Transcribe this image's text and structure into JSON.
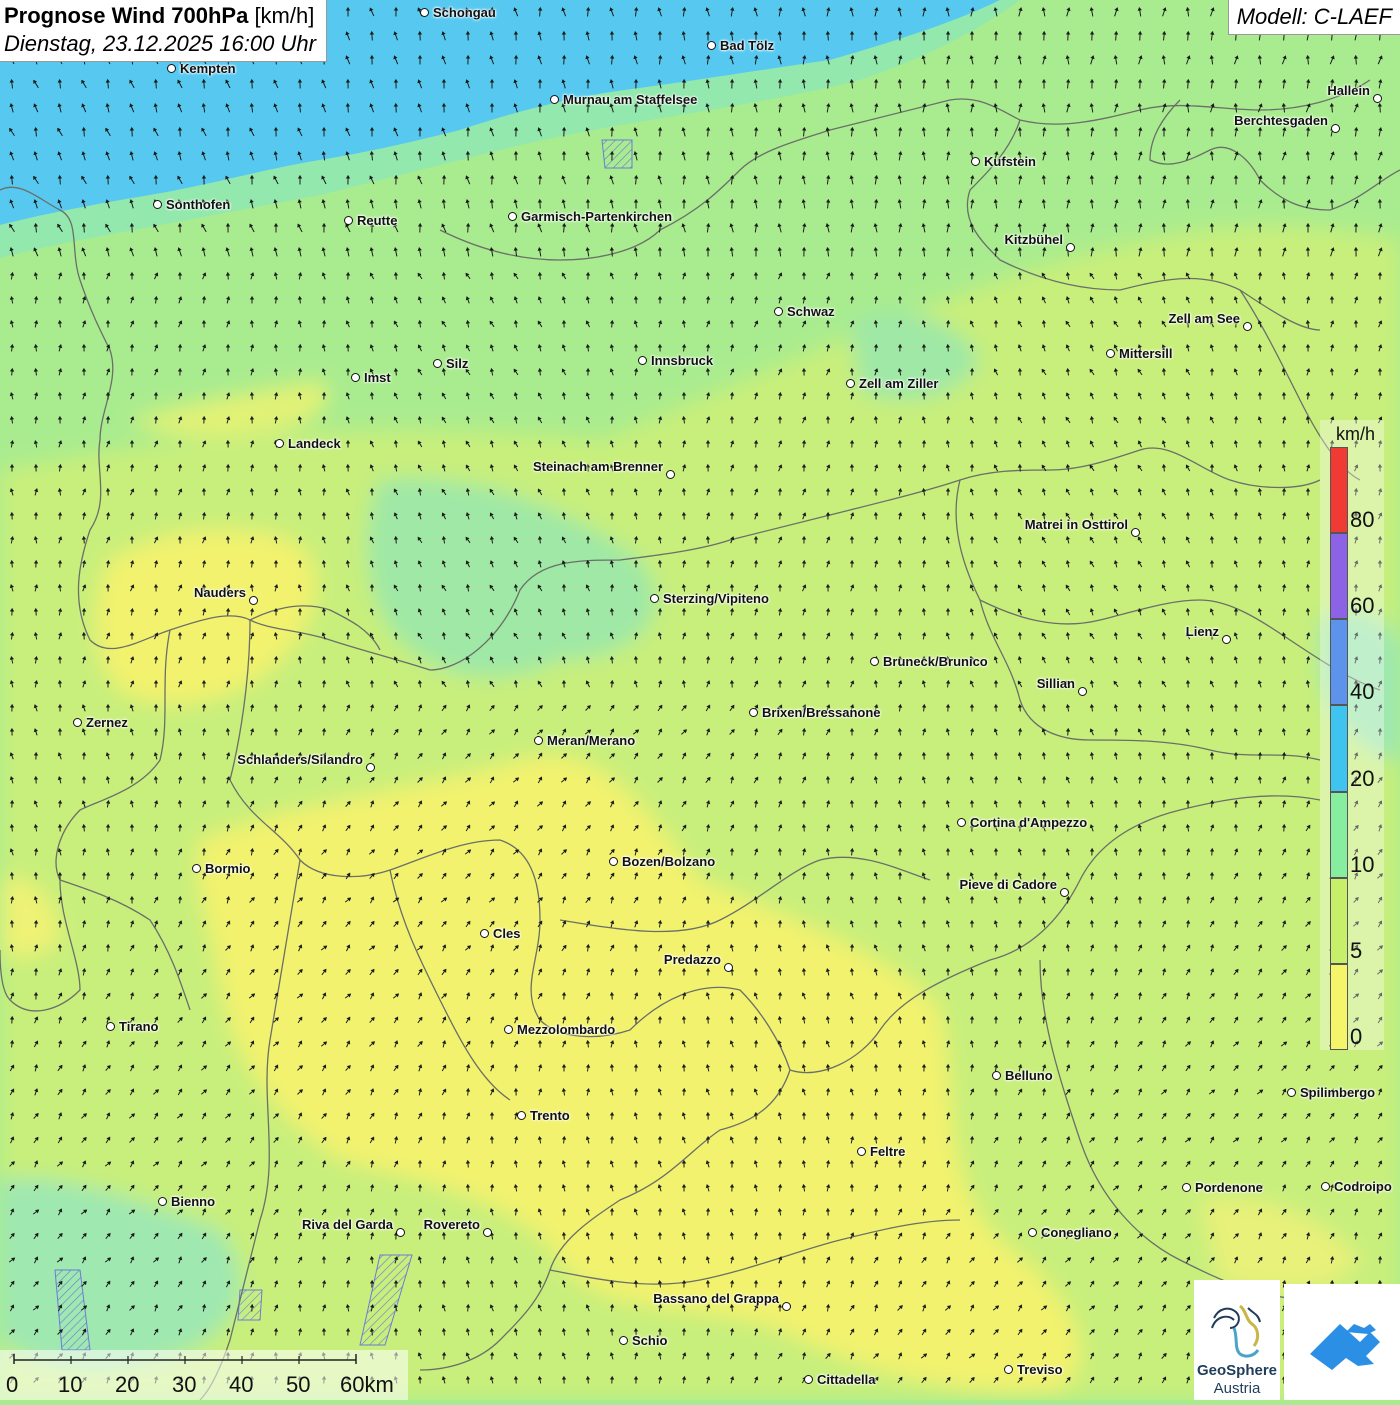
{
  "title": {
    "main_bold": "Prognose Wind 700hPa",
    "unit": "[km/h]",
    "datetime": "Dienstag, 23.12.2025 16:00 Uhr"
  },
  "model": "Modell: C-LAEF",
  "colors": {
    "lake_blue": "#55c8f0",
    "light_green": "#a6ec93",
    "yellow_green": "#ccf07a",
    "yellow": "#f4f26c",
    "mint": "#8ee8b0"
  },
  "cities": [
    {
      "name": "Schongau",
      "label_side": "right"
    },
    {
      "name": "Bad Tölz",
      "label_side": "right"
    },
    {
      "name": "Kempten",
      "label_side": "right"
    },
    {
      "name": "Murnau am Staffelsee",
      "label_side": "right"
    },
    {
      "name": "Hallein",
      "label_side": "left"
    },
    {
      "name": "Berchtesgaden",
      "label_side": "left"
    },
    {
      "name": "Kufstein",
      "label_side": "right"
    },
    {
      "name": "Sonthofen",
      "label_side": "right"
    },
    {
      "name": "Reutte",
      "label_side": "right"
    },
    {
      "name": "Garmisch-Partenkirchen",
      "label_side": "right"
    },
    {
      "name": "Kitzbühel",
      "label_side": "left"
    },
    {
      "name": "Schwaz",
      "label_side": "right"
    },
    {
      "name": "Zell am See",
      "label_side": "left"
    },
    {
      "name": "Mittersill",
      "label_side": "right"
    },
    {
      "name": "Imst",
      "label_side": "right"
    },
    {
      "name": "Silz",
      "label_side": "right"
    },
    {
      "name": "Innsbruck",
      "label_side": "right"
    },
    {
      "name": "Zell am Ziller",
      "label_side": "right"
    },
    {
      "name": "Landeck",
      "label_side": "right"
    },
    {
      "name": "Steinach am Brenner",
      "label_side": "left"
    },
    {
      "name": "Matrei in Osttirol",
      "label_side": "left"
    },
    {
      "name": "Nauders",
      "label_side": "left"
    },
    {
      "name": "Sterzing/Vipiteno",
      "label_side": "right"
    },
    {
      "name": "Lienz",
      "label_side": "left"
    },
    {
      "name": "Bruneck/Brunico",
      "label_side": "right"
    },
    {
      "name": "Sillian",
      "label_side": "left"
    },
    {
      "name": "Brixen/Bressanone",
      "label_side": "right"
    },
    {
      "name": "Zernez",
      "label_side": "right"
    },
    {
      "name": "Meran/Merano",
      "label_side": "right"
    },
    {
      "name": "Schlanders/Silandro",
      "label_side": "left"
    },
    {
      "name": "Cortina d'Ampezzo",
      "label_side": "right"
    },
    {
      "name": "Bozen/Bolzano",
      "label_side": "right"
    },
    {
      "name": "Bormio",
      "label_side": "right"
    },
    {
      "name": "Pieve di Cadore",
      "label_side": "left"
    },
    {
      "name": "Cles",
      "label_side": "right"
    },
    {
      "name": "Predazzo",
      "label_side": "left"
    },
    {
      "name": "Tirano",
      "label_side": "right"
    },
    {
      "name": "Mezzolombardo",
      "label_side": "right"
    },
    {
      "name": "Belluno",
      "label_side": "right"
    },
    {
      "name": "Spilimbergo",
      "label_side": "right"
    },
    {
      "name": "Trento",
      "label_side": "right"
    },
    {
      "name": "Feltre",
      "label_side": "right"
    },
    {
      "name": "Pordenone",
      "label_side": "right"
    },
    {
      "name": "Codroipo",
      "label_side": "right"
    },
    {
      "name": "Bienno",
      "label_side": "right"
    },
    {
      "name": "Riva del Garda",
      "label_side": "left"
    },
    {
      "name": "Rovereto",
      "label_side": "left"
    },
    {
      "name": "Conegliano",
      "label_side": "right"
    },
    {
      "name": "Bassano del Grappa",
      "label_side": "left"
    },
    {
      "name": "Schio",
      "label_side": "right"
    },
    {
      "name": "Treviso",
      "label_side": "right"
    },
    {
      "name": "Cittadella",
      "label_side": "right"
    }
  ],
  "legend": {
    "unit": "km/h",
    "bands": [
      {
        "from": 0,
        "to": 5,
        "color": "#f5f56a"
      },
      {
        "from": 5,
        "to": 10,
        "color": "#c7ef6a"
      },
      {
        "from": 10,
        "to": 20,
        "color": "#86ee9e"
      },
      {
        "from": 20,
        "to": 40,
        "color": "#3fc4f0"
      },
      {
        "from": 40,
        "to": 60,
        "color": "#5e93ec"
      },
      {
        "from": 60,
        "to": 80,
        "color": "#8c63e4"
      },
      {
        "from": 80,
        "to": 100,
        "color": "#f03a34"
      }
    ],
    "ticks": [
      "0",
      "5",
      "10",
      "20",
      "40",
      "60",
      "80"
    ]
  },
  "scale_bar": {
    "labels": [
      "0",
      "10",
      "20",
      "30",
      "40",
      "50",
      "60km"
    ]
  },
  "logos": {
    "geosphere_line1": "GeoSphere",
    "geosphere_line2": "Austria"
  }
}
